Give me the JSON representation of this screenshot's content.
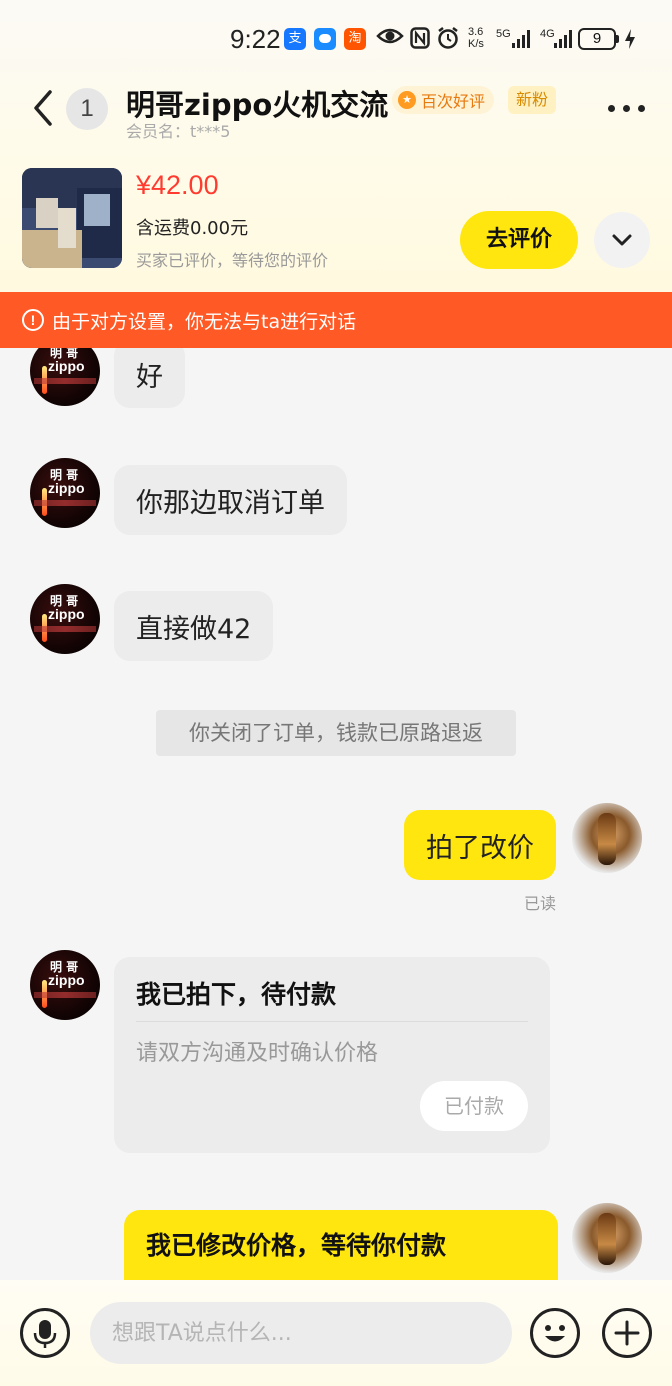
{
  "status_bar": {
    "time": "9:22",
    "apps": [
      "支",
      "",
      "淘"
    ],
    "net_speed_top": "3.6",
    "net_speed_bottom": "K/s",
    "signal1": "5G",
    "signal2": "4G",
    "battery": "9"
  },
  "header": {
    "unread_count": "1",
    "title": "明哥zippo火机交流",
    "tag_praise": "百次好评",
    "tag_newfan": "新粉",
    "member_name": "会员名：t***5"
  },
  "product": {
    "price": "¥42.00",
    "shipping": "含运费0.00元",
    "review_note": "买家已评价，等待您的评价",
    "review_button": "去评价"
  },
  "warning": {
    "text": "由于对方设置，你无法与ta进行对话"
  },
  "messages": {
    "m1": "好",
    "m2": "你那边取消订单",
    "m3": "直接做42",
    "system_note": "你关闭了订单，钱款已原路退返",
    "m4": "拍了改价",
    "read_label": "已读",
    "card_left_title": "我已拍下，待付款",
    "card_left_sub": "请双方沟通及时确认价格",
    "card_left_button": "已付款",
    "card_right_title": "我已修改价格，等待你付款"
  },
  "avatar_left": {
    "line1": "明 哥",
    "line2": "zippo"
  },
  "input": {
    "placeholder": "想跟TA说点什么..."
  },
  "colors": {
    "accent_yellow": "#ffe60f",
    "warning_orange": "#ff5a26",
    "price_red": "#ff3b30"
  }
}
